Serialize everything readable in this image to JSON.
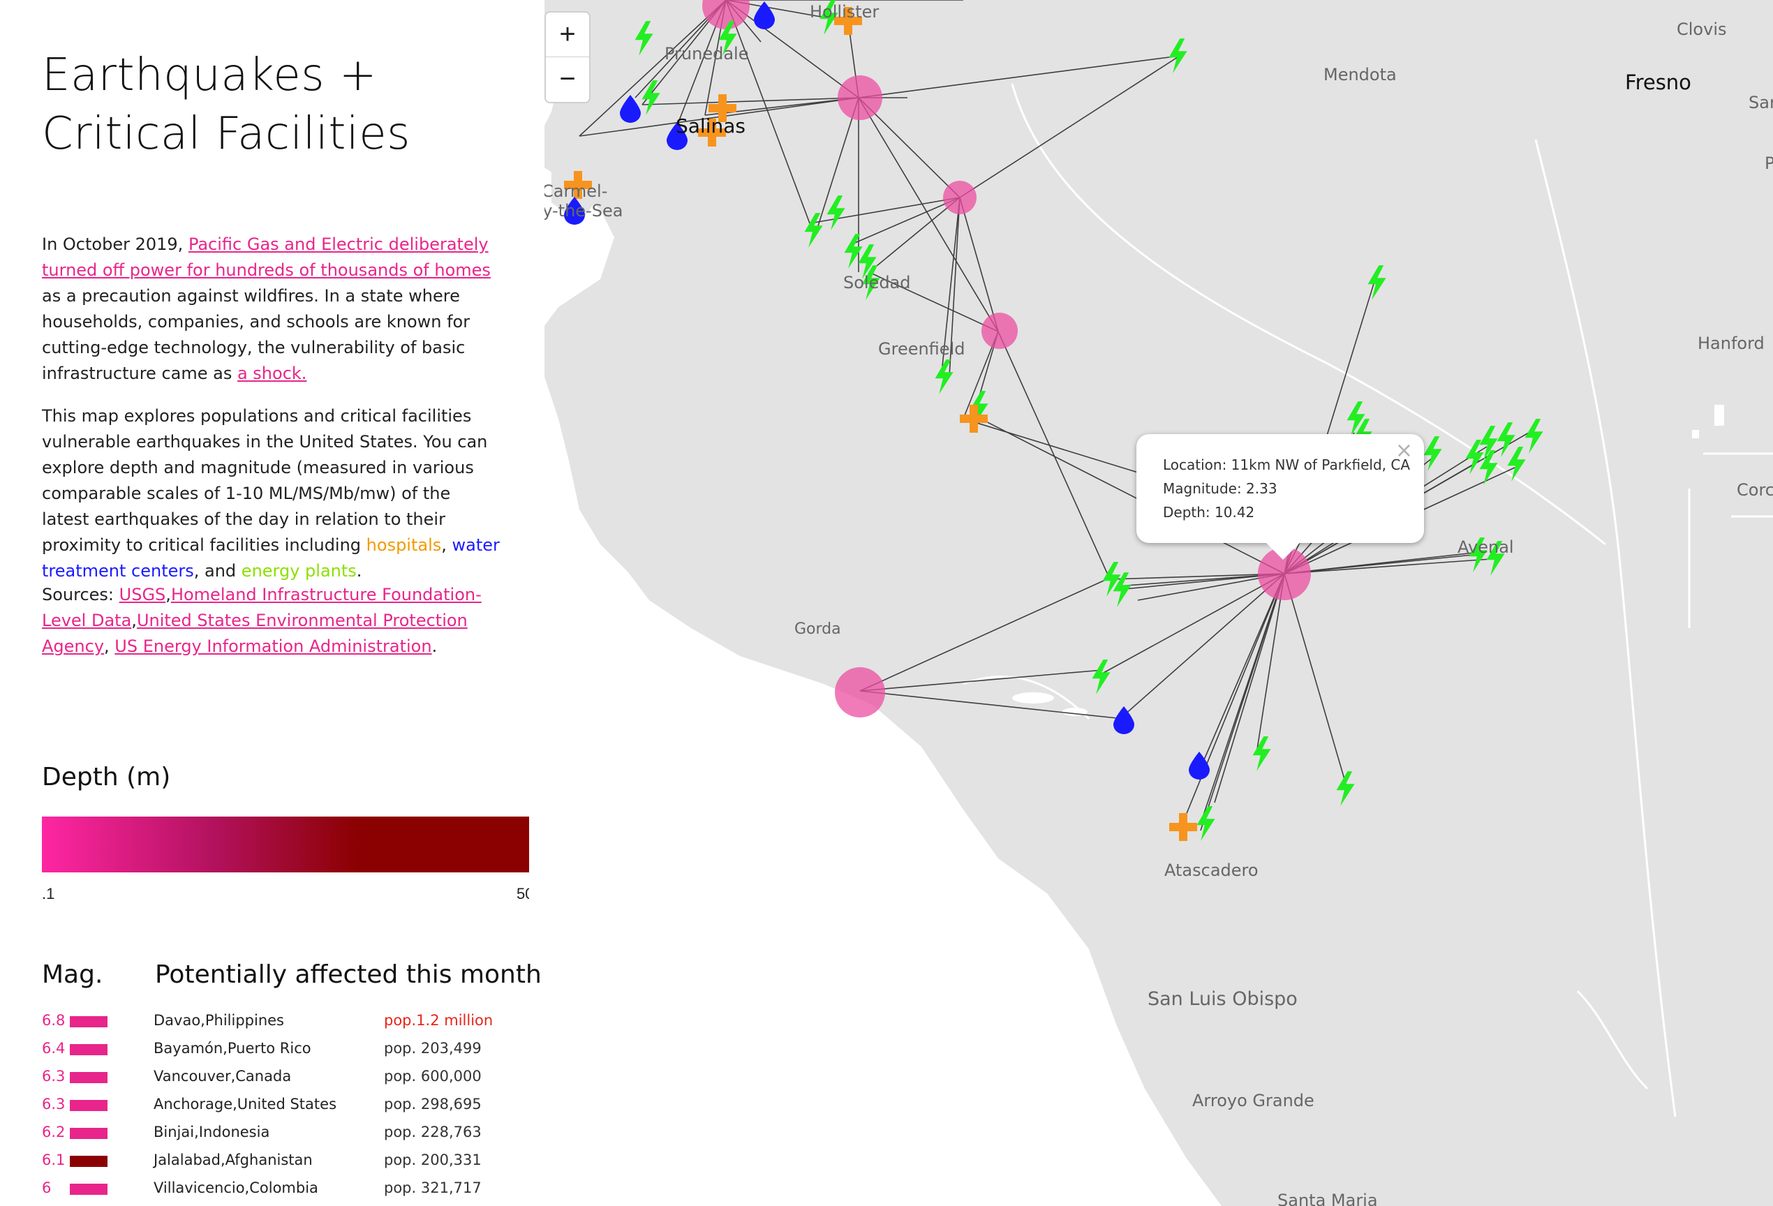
{
  "title": "Earthquakes + Critical Facilities",
  "intro": {
    "p1_before": "In October 2019, ",
    "p1_link1": "Pacific Gas and Electric deliberately turned off power for hundreds of thousands of homes",
    "p1_mid": " as a precaution against wildfires. In a state where households, companies, and schools are known for cutting-edge technology, the vulnerability of basic infrastructure came as ",
    "p1_link2": "a shock.",
    "p2_text": "This map explores populations and critical facilities vulnerable earthquakes in the United States. You can explore depth and magnitude (measured in various comparable scales of 1-10 ML/MS/Mb/mw) of the latest earthquakes of the day in relation to their proximity to critical facilities including ",
    "p2_hospitals": "hospitals",
    "p2_comma": ", ",
    "p2_water": "water treatment centers",
    "p2_and": ", and ",
    "p2_energy": "energy plants",
    "p2_end": ".",
    "sources_label": "Sources: ",
    "source1": "USGS",
    "source2": "Homeland Infrastructure Foundation-Level Data",
    "source3": "United States Environmental Protection Agency",
    "source4": "US Energy Information Administration",
    "sources_end": "."
  },
  "legend": {
    "depth_title": "Depth (m)",
    "min_label": ".1",
    "max_label": "50"
  },
  "table": {
    "mag_header": "Mag.",
    "affected_header": "Potentially affected this month",
    "rows": [
      {
        "mag": "6.8",
        "place": "Davao,Philippines",
        "pop": "pop.1.2 million",
        "bar_color": "#e8258a",
        "pop_color": "#e8251a"
      },
      {
        "mag": "6.4",
        "place": "Bayamón,Puerto Rico",
        "pop": "pop. 203,499",
        "bar_color": "#e8258a",
        "pop_color": "#333333"
      },
      {
        "mag": "6.3",
        "place": "Vancouver,Canada",
        "pop": "pop. 600,000",
        "bar_color": "#e8258a",
        "pop_color": "#333333"
      },
      {
        "mag": "6.3",
        "place": "Anchorage,United States",
        "pop": "pop. 298,695",
        "bar_color": "#e8258a",
        "pop_color": "#333333"
      },
      {
        "mag": "6.2",
        "place": "Binjai,Indonesia",
        "pop": "pop. 228,763",
        "bar_color": "#e8258a",
        "pop_color": "#333333"
      },
      {
        "mag": "6.1",
        "place": "Jalalabad,Afghanistan",
        "pop": "pop. 200,331",
        "bar_color": "#8b0000",
        "pop_color": "#333333"
      },
      {
        "mag": "6",
        "place": "Villavicencio,Colombia",
        "pop": "pop. 321,717",
        "bar_color": "#e8258a",
        "pop_color": "#333333"
      }
    ]
  },
  "zoom": {
    "in": "+",
    "out": "−"
  },
  "popup": {
    "location": "Location: 11km NW of Parkfield, CA",
    "magnitude": "Magnitude: 2.33",
    "depth": "Depth: 10.42",
    "close": "×"
  },
  "cities": {
    "clovis": "Clovis",
    "mendota": "Mendota",
    "fresno": "Fresno",
    "san": "San",
    "p": "P",
    "hanford": "Hanford",
    "corc": "Corc",
    "greenfield": "Greenfield",
    "soledad": "Soledad",
    "gorda": "Gorda",
    "avenal": "Avenal",
    "atascadero": "Atascadero",
    "slo": "San Luis Obispo",
    "arroyo": "Arroyo Grande",
    "santamaria": "Santa Maria",
    "salinas": "Salinas",
    "prunedale": "Prunedale",
    "hollister": "Hollister",
    "carmel1": "Carmel-",
    "carmel2": "by-the-Sea"
  },
  "colors": {
    "quake": "#ec4fa1",
    "hospital": "#f7941d",
    "water": "#1a1aff",
    "energy": "#22ee22",
    "land": "#e3e3e3",
    "sea": "#ffffff"
  }
}
